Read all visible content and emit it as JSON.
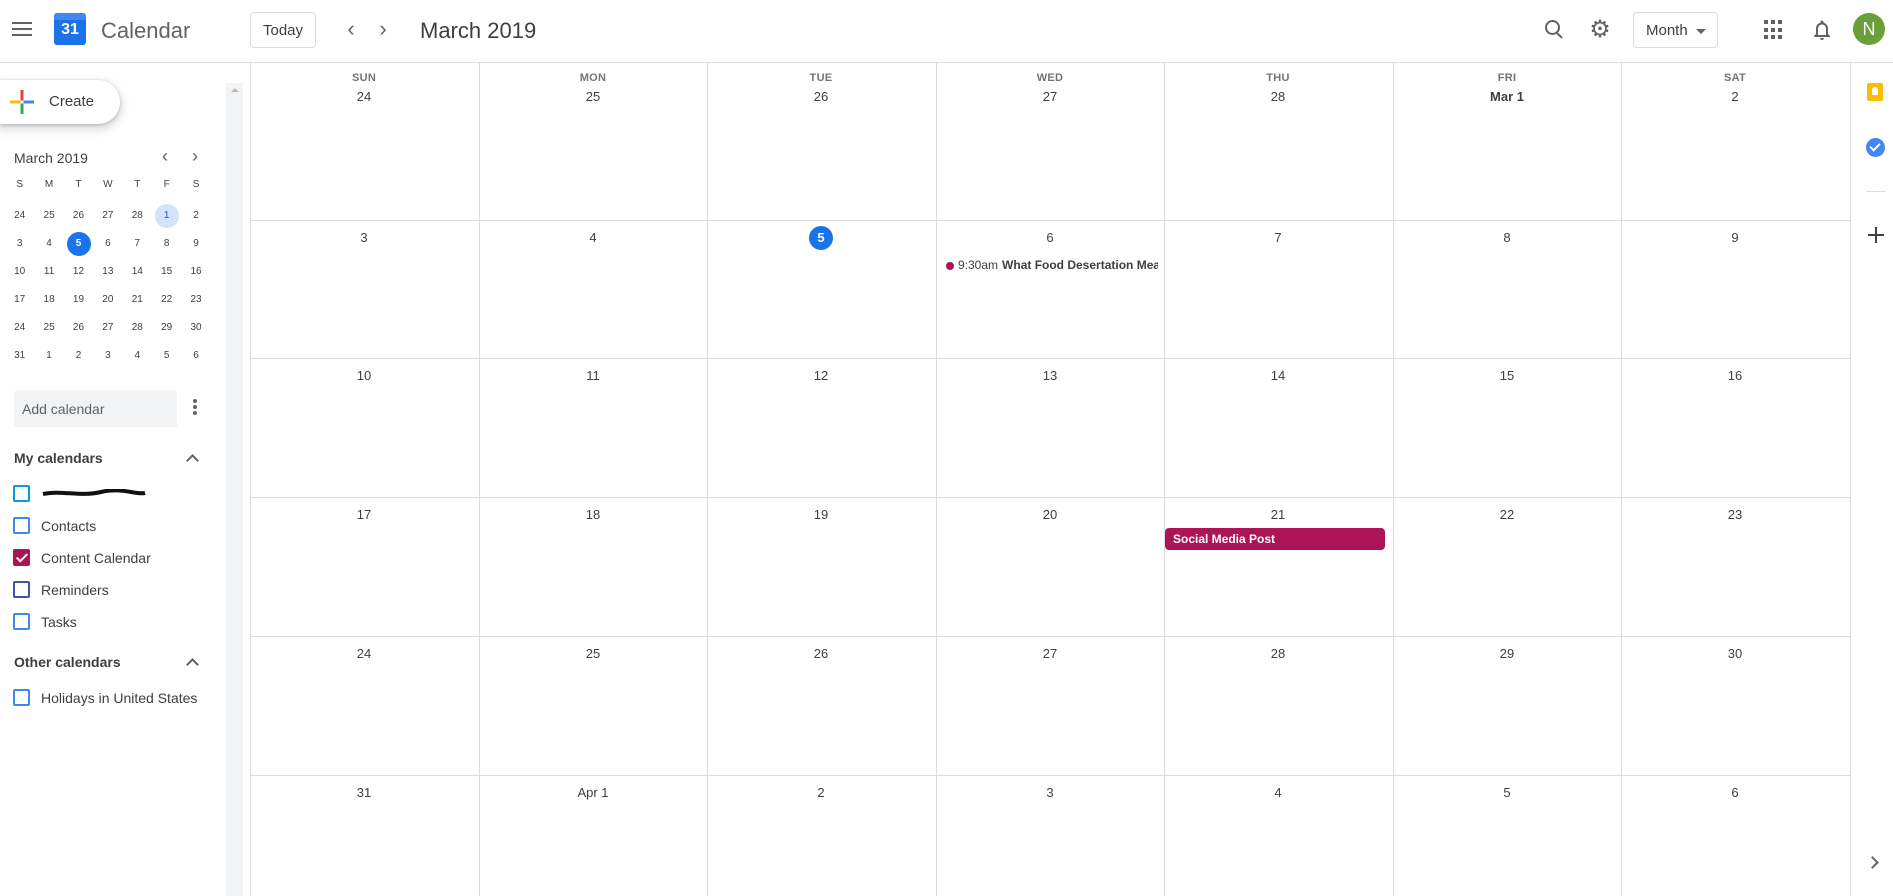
{
  "app": {
    "title": "Calendar",
    "logo_day": "31"
  },
  "header": {
    "today_label": "Today",
    "prev": "‹",
    "next": "›",
    "title": "March 2019",
    "view": "Month",
    "avatar_initial": "N"
  },
  "sidebar": {
    "create_label": "Create",
    "mini_title": "March 2019",
    "mini_headers": [
      "S",
      "M",
      "T",
      "W",
      "T",
      "F",
      "S"
    ],
    "mini_weeks": [
      [
        "24",
        "25",
        "26",
        "27",
        "28",
        "1",
        "2"
      ],
      [
        "3",
        "4",
        "5",
        "6",
        "7",
        "8",
        "9"
      ],
      [
        "10",
        "11",
        "12",
        "13",
        "14",
        "15",
        "16"
      ],
      [
        "17",
        "18",
        "19",
        "20",
        "21",
        "22",
        "23"
      ],
      [
        "24",
        "25",
        "26",
        "27",
        "28",
        "29",
        "30"
      ],
      [
        "31",
        "1",
        "2",
        "3",
        "4",
        "5",
        "6"
      ]
    ],
    "add_calendar_placeholder": "Add calendar",
    "my_calendars_title": "My calendars",
    "my_calendars": [
      {
        "label": "",
        "color": "#039be5",
        "checked": false,
        "redacted": true
      },
      {
        "label": "Contacts",
        "color": "#4285f4",
        "checked": false
      },
      {
        "label": "Content Calendar",
        "color": "#ad1457",
        "checked": true
      },
      {
        "label": "Reminders",
        "color": "#3f51b5",
        "checked": false
      },
      {
        "label": "Tasks",
        "color": "#4285f4",
        "checked": false
      }
    ],
    "other_calendars_title": "Other calendars",
    "other_calendars": [
      {
        "label": "Holidays in United States",
        "color": "#4285f4",
        "checked": false
      }
    ]
  },
  "month": {
    "day_headers": [
      "SUN",
      "MON",
      "TUE",
      "WED",
      "THU",
      "FRI",
      "SAT"
    ],
    "weeks": [
      [
        "24",
        "25",
        "26",
        "27",
        "28",
        "Mar 1",
        "2"
      ],
      [
        "3",
        "4",
        "5",
        "6",
        "7",
        "8",
        "9"
      ],
      [
        "10",
        "11",
        "12",
        "13",
        "14",
        "15",
        "16"
      ],
      [
        "17",
        "18",
        "19",
        "20",
        "21",
        "22",
        "23"
      ],
      [
        "24",
        "25",
        "26",
        "27",
        "28",
        "29",
        "30"
      ],
      [
        "31",
        "Apr 1",
        "2",
        "3",
        "4",
        "5",
        "6"
      ]
    ],
    "events": [
      {
        "time": "9:30am",
        "title": "What Food Desertation Mean",
        "color": "#ad1457",
        "kind": "dot"
      },
      {
        "title": "Social Media Post",
        "color": "#ad1457",
        "kind": "block"
      }
    ]
  },
  "colors": {
    "accent": "#1a73e8",
    "today_selected_bg": "#d2e3fc"
  }
}
